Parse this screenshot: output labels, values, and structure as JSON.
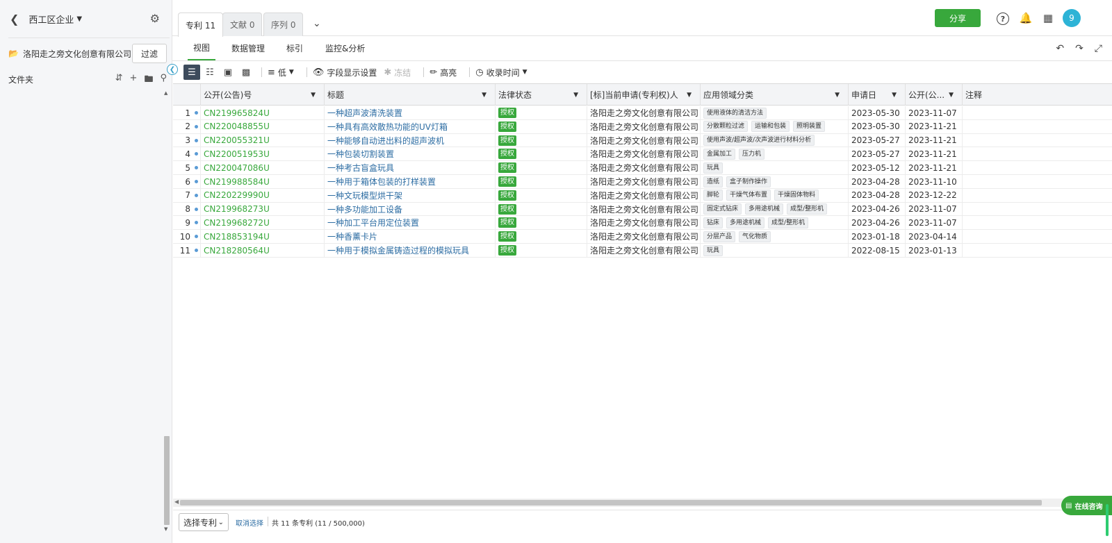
{
  "sidebar": {
    "workspace": "西工区企业",
    "company": "洛阳走之旁文化创意有限公司",
    "filter_label": "过滤",
    "folders_label": "文件夹"
  },
  "tabs": [
    {
      "label": "专利 11"
    },
    {
      "label": "文献 0"
    },
    {
      "label": "序列 0"
    }
  ],
  "header": {
    "share_label": "分享",
    "avatar_text": "9"
  },
  "subnav": [
    "视图",
    "数据管理",
    "标引",
    "监控&分析"
  ],
  "toolbar": {
    "density_label": "低",
    "fields_label": "字段显示设置",
    "freeze_label": "冻结",
    "highlight_label": "高亮",
    "collect_time_label": "收录时间"
  },
  "table": {
    "columns": [
      "公开(公告)号",
      "标题",
      "法律状态",
      "[标]当前申请(专利权)人",
      "应用领域分类",
      "申请日",
      "公开(公...",
      "注释"
    ],
    "rows": [
      {
        "n": "1",
        "pub": "CN219965824U",
        "title": "一种超声波清洗装置",
        "status": "授权",
        "applicant": "洛阳走之旁文化创意有限公司",
        "tags": [
          "使用液体的清洁方法"
        ],
        "app_date": "2023-05-30",
        "pub_date": "2023-11-07"
      },
      {
        "n": "2",
        "pub": "CN220048855U",
        "title": "一种具有高效散热功能的UV灯箱",
        "status": "授权",
        "applicant": "洛阳走之旁文化创意有限公司",
        "tags": [
          "分散颗粒过滤",
          "运输和包装",
          "照明装置"
        ],
        "app_date": "2023-05-30",
        "pub_date": "2023-11-21"
      },
      {
        "n": "3",
        "pub": "CN220055321U",
        "title": "一种能够自动进出料的超声波机",
        "status": "授权",
        "applicant": "洛阳走之旁文化创意有限公司",
        "tags": [
          "使用声波/超声波/次声波进行材料分析"
        ],
        "app_date": "2023-05-27",
        "pub_date": "2023-11-21"
      },
      {
        "n": "4",
        "pub": "CN220051953U",
        "title": "一种包装切割装置",
        "status": "授权",
        "applicant": "洛阳走之旁文化创意有限公司",
        "tags": [
          "金属加工",
          "压力机"
        ],
        "app_date": "2023-05-27",
        "pub_date": "2023-11-21"
      },
      {
        "n": "5",
        "pub": "CN220047086U",
        "title": "一种考古盲盒玩具",
        "status": "授权",
        "applicant": "洛阳走之旁文化创意有限公司",
        "tags": [
          "玩具"
        ],
        "app_date": "2023-05-12",
        "pub_date": "2023-11-21"
      },
      {
        "n": "6",
        "pub": "CN219988584U",
        "title": "一种用于箱体包装的打样装置",
        "status": "授权",
        "applicant": "洛阳走之旁文化创意有限公司",
        "tags": [
          "造纸",
          "盒子制作操作"
        ],
        "app_date": "2023-04-28",
        "pub_date": "2023-11-10"
      },
      {
        "n": "7",
        "pub": "CN220229990U",
        "title": "一种文玩模型烘干架",
        "status": "授权",
        "applicant": "洛阳走之旁文化创意有限公司",
        "tags": [
          "脚轮",
          "干燥气体布置",
          "干燥固体物料"
        ],
        "app_date": "2023-04-28",
        "pub_date": "2023-12-22"
      },
      {
        "n": "8",
        "pub": "CN219968273U",
        "title": "一种多功能加工设备",
        "status": "授权",
        "applicant": "洛阳走之旁文化创意有限公司",
        "tags": [
          "固定式钻床",
          "多用途机械",
          "成型/整形机"
        ],
        "app_date": "2023-04-26",
        "pub_date": "2023-11-07"
      },
      {
        "n": "9",
        "pub": "CN219968272U",
        "title": "一种加工平台用定位装置",
        "status": "授权",
        "applicant": "洛阳走之旁文化创意有限公司",
        "tags": [
          "钻床",
          "多用途机械",
          "成型/整形机"
        ],
        "app_date": "2023-04-26",
        "pub_date": "2023-11-07"
      },
      {
        "n": "10",
        "pub": "CN218853194U",
        "title": "一种香薰卡片",
        "status": "授权",
        "applicant": "洛阳走之旁文化创意有限公司",
        "tags": [
          "分层产品",
          "气化物质"
        ],
        "app_date": "2023-01-18",
        "pub_date": "2023-04-14"
      },
      {
        "n": "11",
        "pub": "CN218280564U",
        "title": "一种用于模拟金属铸造过程的模拟玩具",
        "status": "授权",
        "applicant": "洛阳走之旁文化创意有限公司",
        "tags": [
          "玩具"
        ],
        "app_date": "2022-08-15",
        "pub_date": "2023-01-13"
      }
    ]
  },
  "footer": {
    "select_label": "选择专利",
    "cancel_label": "取消选择",
    "count_text": "共 11 条专利 (11 / 500,000)"
  },
  "chat": {
    "label": "在线咨询"
  },
  "colors": {
    "accent_green": "#38a83c",
    "link_blue": "#2d6da3",
    "avatar_blue": "#2db3d6"
  }
}
